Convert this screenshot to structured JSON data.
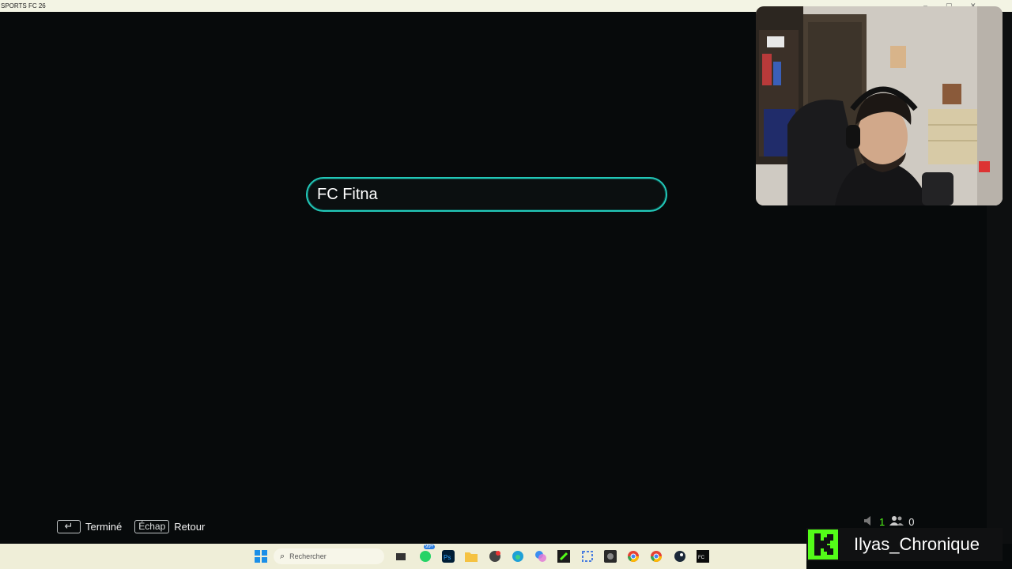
{
  "window": {
    "title": "SPORTS FC 26"
  },
  "name_field": {
    "value": "FC Fitna"
  },
  "hints": [
    {
      "key": "↵",
      "label": "Terminé"
    },
    {
      "key": "Échap",
      "label": "Retour"
    }
  ],
  "taskbar": {
    "search_placeholder": "Rechercher",
    "whatsapp_badge": "99+"
  },
  "stream": {
    "viewers_count": "1",
    "followers_count": "0",
    "streamer_name": "Ilyas_Chronique",
    "brand_color": "#53fc18"
  },
  "colors": {
    "input_border": "#22c7b8",
    "background": "#070a0b"
  }
}
